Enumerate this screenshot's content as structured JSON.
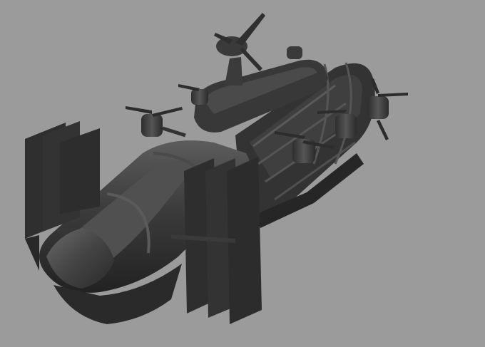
{
  "viewport": {
    "background": "#9b9b9b",
    "subject": "airship-3d-model",
    "shading": "untextured-gray-render"
  },
  "colors": {
    "hull_dark": "#2a2a2a",
    "hull_mid": "#3a3a3a",
    "hull_light": "#5a5a5a",
    "highlight": "#6e6e6e",
    "fin": "#2f2f2f"
  }
}
